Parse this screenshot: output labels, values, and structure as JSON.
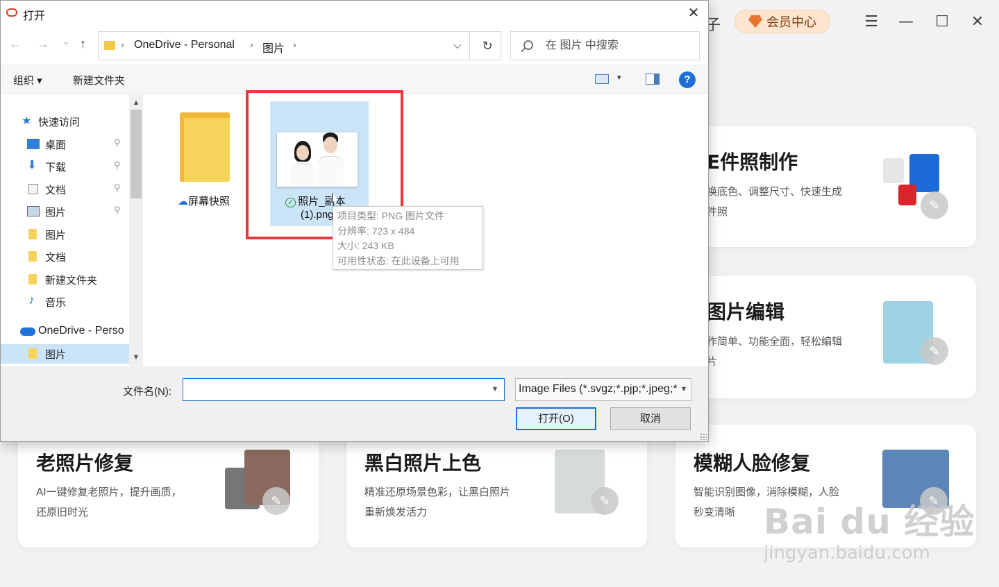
{
  "dialog": {
    "title": "打开",
    "close_glyph": "✕",
    "nav": {
      "back": "←",
      "forward": "→",
      "recent": "⌄",
      "up": "↑"
    },
    "breadcrumb": [
      "OneDrive - Personal",
      "图片"
    ],
    "crumb_sep": "›",
    "dropdown_glyph": "⌵",
    "refresh_glyph": "↻",
    "search_placeholder": "在 图片 中搜索",
    "toolbar": {
      "organize": "组织 ▾",
      "new_folder": "新建文件夹",
      "view_caret": "▾",
      "help": "?"
    },
    "sidebar": {
      "quick_access": "快速访问",
      "items": [
        {
          "label": "桌面",
          "icon": "desktop-icon",
          "pinned": true
        },
        {
          "label": "下载",
          "icon": "download-icon",
          "pinned": true
        },
        {
          "label": "文档",
          "icon": "document-icon",
          "pinned": true
        },
        {
          "label": "图片",
          "icon": "pictures-icon",
          "pinned": true
        },
        {
          "label": "图片",
          "icon": "folder-icon",
          "pinned": false
        },
        {
          "label": "文档",
          "icon": "folder-icon",
          "pinned": false
        },
        {
          "label": "新建文件夹",
          "icon": "folder-icon",
          "pinned": false
        },
        {
          "label": "音乐",
          "icon": "music-icon",
          "pinned": false
        }
      ],
      "onedrive": "OneDrive - Perso",
      "selected": "图片",
      "pin_glyph": "📌",
      "scroll_up": "▲",
      "scroll_down": "▼"
    },
    "files": [
      {
        "name": "屏幕快照",
        "type": "folder",
        "status_icon": "cloud-icon",
        "status_glyph": "☁"
      },
      {
        "name_line1": "照片_副本",
        "name_line2": "(1).png",
        "type": "image",
        "status_icon": "check-circle-icon",
        "status_glyph": "✓",
        "selected": true
      }
    ],
    "tooltip": {
      "type": "项目类型: PNG 图片文件",
      "resolution": "分辨率: 723 x 484",
      "size": "大小: 243 KB",
      "availability": "可用性状态: 在此设备上可用"
    },
    "filename_label": "文件名(N):",
    "filename_value": "",
    "filter": "Image Files (*.svgz;*.pjp;*.jpeg;*.jpg)",
    "open_button": "打开(O)",
    "cancel_button": "取消"
  },
  "app": {
    "partial_top": "子",
    "vip_label": "会员中心",
    "window_controls": {
      "menu": "☰",
      "minimize": "—",
      "maximize": "☐",
      "close": "✕"
    },
    "cards": [
      {
        "title": "证件照制作",
        "visible_title": "E件照制作",
        "desc1": "换底色、调整尺寸、快速生成",
        "desc2": "件照"
      },
      {
        "title": "图片编辑",
        "visible_title": "图片编辑",
        "desc1": "作简单、功能全面，轻松编辑",
        "desc2": "片"
      },
      {
        "title": "老照片修复",
        "desc1": "AI一键修复老照片，提升画质，",
        "desc2": "还原旧时光"
      },
      {
        "title": "黑白照片上色",
        "desc1": "精准还原场景色彩，让黑白照片",
        "desc2": "重新焕发活力"
      },
      {
        "title": "模糊人脸修复",
        "desc1": "智能识别图像，消除模糊，人脸",
        "desc2": "秒变清晰"
      }
    ],
    "edit_glyph": "✎"
  },
  "watermark": {
    "text": "Bai du 经验",
    "sub": "jingyan.baidu.com"
  },
  "colors": {
    "accent_blue": "#1e6fd6",
    "highlight_red": "#e8383d",
    "selection": "#cce4f7",
    "folder_yellow": "#f8d35c"
  }
}
